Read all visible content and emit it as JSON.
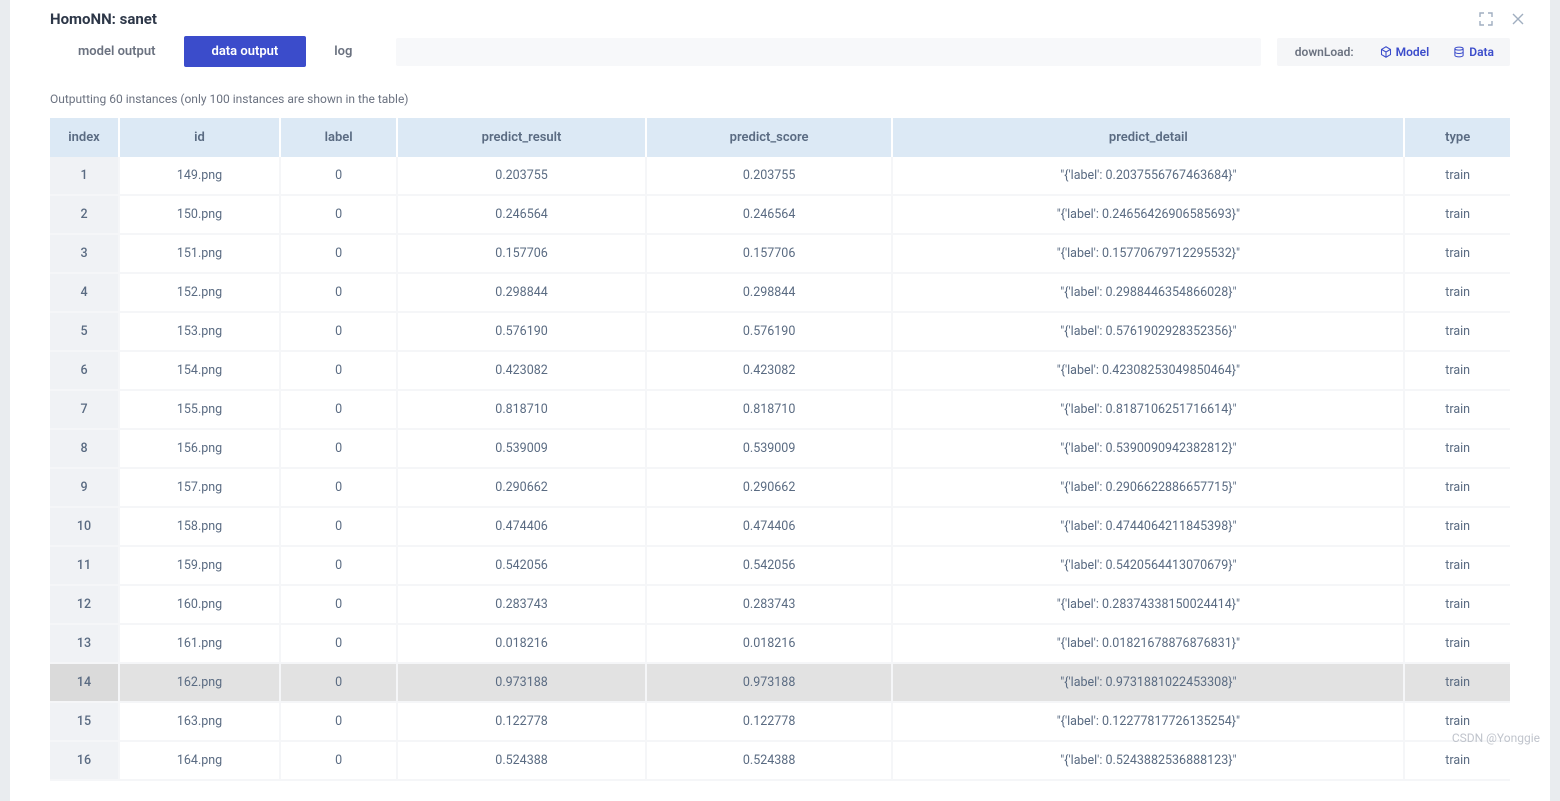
{
  "header": {
    "title": "HomoNN: sanet"
  },
  "tabs": [
    {
      "label": "model output",
      "active": false
    },
    {
      "label": "data output",
      "active": true
    },
    {
      "label": "log",
      "active": false
    }
  ],
  "download": {
    "label": "downLoad:",
    "model_btn": "Model",
    "data_btn": "Data"
  },
  "subtitle": "Outputting 60 instances (only 100 instances are shown in the table)",
  "columns": [
    "index",
    "id",
    "label",
    "predict_result",
    "predict_score",
    "predict_detail",
    "type"
  ],
  "rows": [
    {
      "index": 1,
      "id": "149.png",
      "label": 0,
      "predict_result": "0.203755",
      "predict_score": "0.203755",
      "predict_detail": "\"{'label': 0.2037556767463684}\"",
      "type": "train"
    },
    {
      "index": 2,
      "id": "150.png",
      "label": 0,
      "predict_result": "0.246564",
      "predict_score": "0.246564",
      "predict_detail": "\"{'label': 0.24656426906585693}\"",
      "type": "train"
    },
    {
      "index": 3,
      "id": "151.png",
      "label": 0,
      "predict_result": "0.157706",
      "predict_score": "0.157706",
      "predict_detail": "\"{'label': 0.15770679712295532}\"",
      "type": "train"
    },
    {
      "index": 4,
      "id": "152.png",
      "label": 0,
      "predict_result": "0.298844",
      "predict_score": "0.298844",
      "predict_detail": "\"{'label': 0.2988446354866028}\"",
      "type": "train"
    },
    {
      "index": 5,
      "id": "153.png",
      "label": 0,
      "predict_result": "0.576190",
      "predict_score": "0.576190",
      "predict_detail": "\"{'label': 0.5761902928352356}\"",
      "type": "train"
    },
    {
      "index": 6,
      "id": "154.png",
      "label": 0,
      "predict_result": "0.423082",
      "predict_score": "0.423082",
      "predict_detail": "\"{'label': 0.42308253049850464}\"",
      "type": "train"
    },
    {
      "index": 7,
      "id": "155.png",
      "label": 0,
      "predict_result": "0.818710",
      "predict_score": "0.818710",
      "predict_detail": "\"{'label': 0.8187106251716614}\"",
      "type": "train"
    },
    {
      "index": 8,
      "id": "156.png",
      "label": 0,
      "predict_result": "0.539009",
      "predict_score": "0.539009",
      "predict_detail": "\"{'label': 0.5390090942382812}\"",
      "type": "train"
    },
    {
      "index": 9,
      "id": "157.png",
      "label": 0,
      "predict_result": "0.290662",
      "predict_score": "0.290662",
      "predict_detail": "\"{'label': 0.2906622886657715}\"",
      "type": "train"
    },
    {
      "index": 10,
      "id": "158.png",
      "label": 0,
      "predict_result": "0.474406",
      "predict_score": "0.474406",
      "predict_detail": "\"{'label': 0.4744064211845398}\"",
      "type": "train"
    },
    {
      "index": 11,
      "id": "159.png",
      "label": 0,
      "predict_result": "0.542056",
      "predict_score": "0.542056",
      "predict_detail": "\"{'label': 0.5420564413070679}\"",
      "type": "train"
    },
    {
      "index": 12,
      "id": "160.png",
      "label": 0,
      "predict_result": "0.283743",
      "predict_score": "0.283743",
      "predict_detail": "\"{'label': 0.28374338150024414}\"",
      "type": "train"
    },
    {
      "index": 13,
      "id": "161.png",
      "label": 0,
      "predict_result": "0.018216",
      "predict_score": "0.018216",
      "predict_detail": "\"{'label': 0.01821678876876831}\"",
      "type": "train"
    },
    {
      "index": 14,
      "id": "162.png",
      "label": 0,
      "predict_result": "0.973188",
      "predict_score": "0.973188",
      "predict_detail": "\"{'label': 0.9731881022453308}\"",
      "type": "train",
      "hovered": true
    },
    {
      "index": 15,
      "id": "163.png",
      "label": 0,
      "predict_result": "0.122778",
      "predict_score": "0.122778",
      "predict_detail": "\"{'label': 0.12277817726135254}\"",
      "type": "train"
    },
    {
      "index": 16,
      "id": "164.png",
      "label": 0,
      "predict_result": "0.524388",
      "predict_score": "0.524388",
      "predict_detail": "\"{'label': 0.5243882536888123}\"",
      "type": "train"
    }
  ],
  "watermark": "CSDN @Yonggie"
}
